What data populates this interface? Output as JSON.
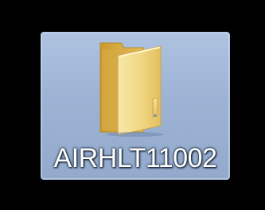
{
  "desktop": {
    "folder": {
      "name": "AIRHLT11002",
      "icon": "folder-icon",
      "selected": true
    }
  },
  "colors": {
    "background": "#000000",
    "selection": "#9db3d4",
    "selection_border": "#a9c2e6",
    "folder_front": "#f1d98a",
    "folder_back": "#e6bf55"
  }
}
